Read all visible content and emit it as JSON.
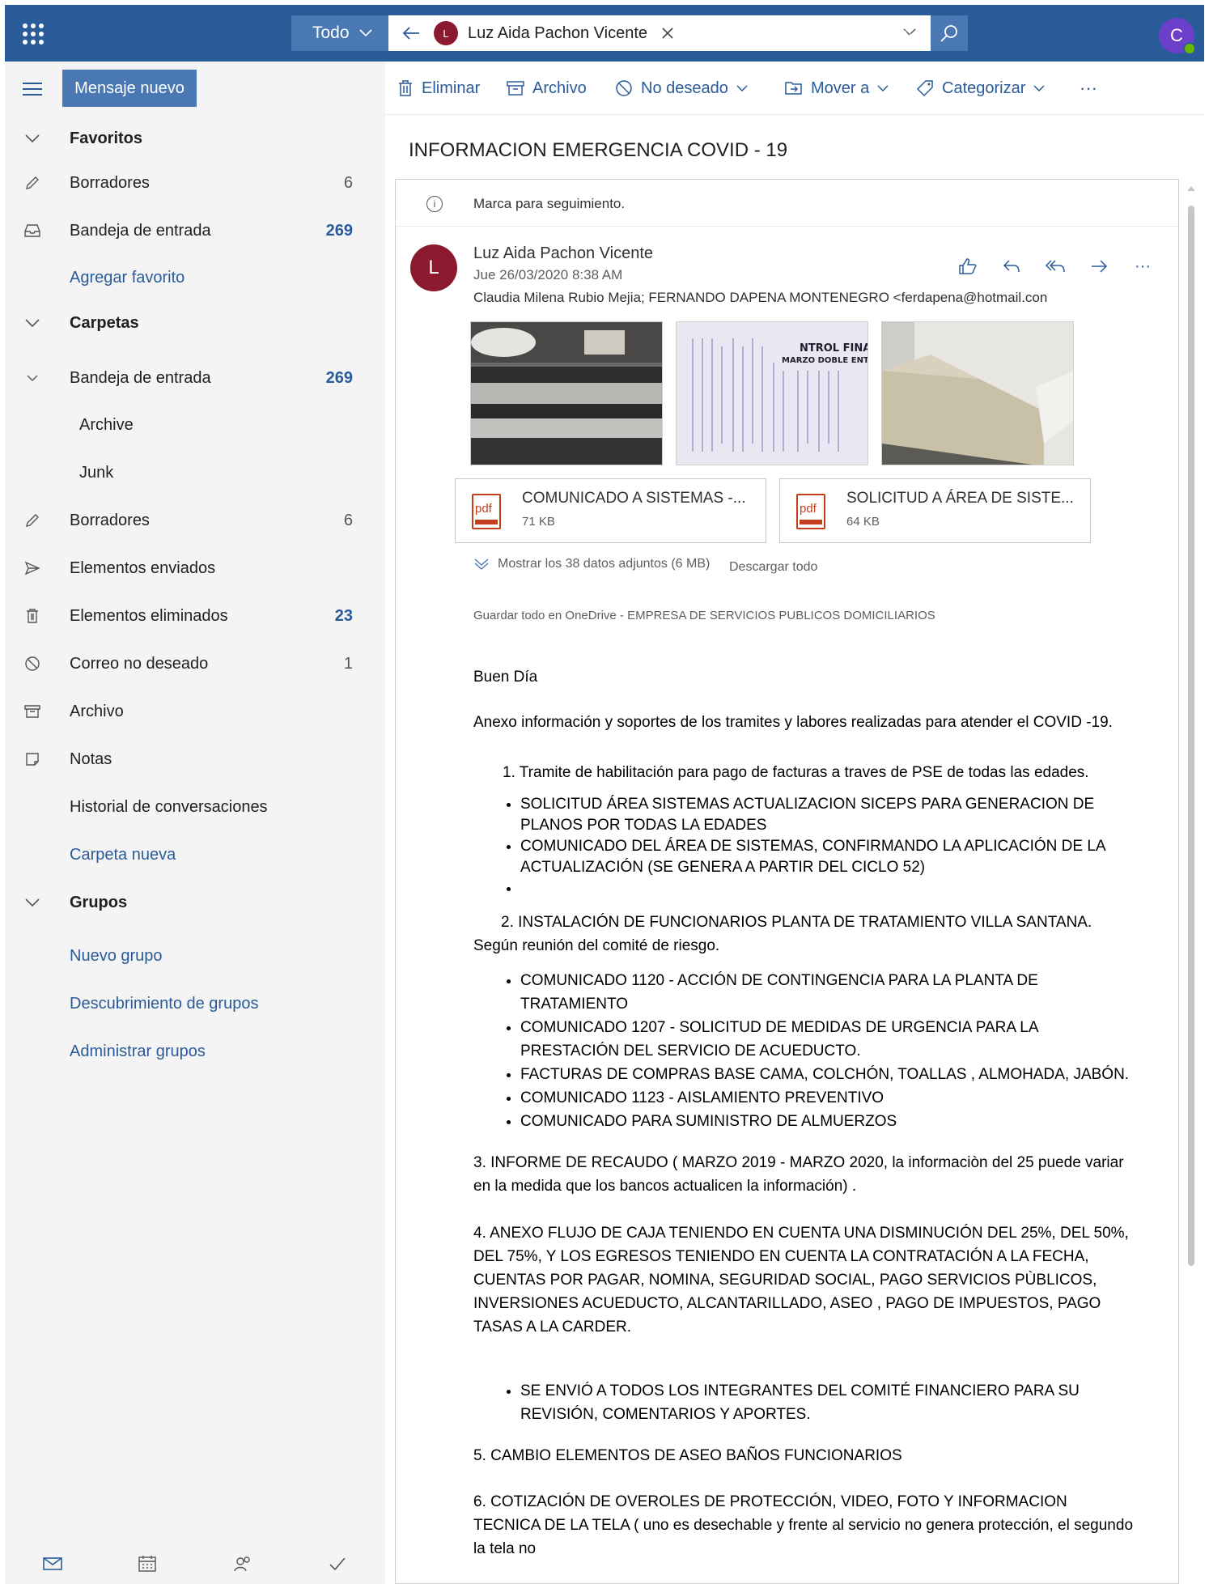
{
  "header": {
    "scope_label": "Todo",
    "search_pill_initial": "L",
    "search_pill_name": "Luz Aida Pachon Vicente",
    "user_initial": "C"
  },
  "toolbar": {
    "new_message": "Mensaje nuevo",
    "delete": "Eliminar",
    "archive": "Archivo",
    "junk": "No deseado",
    "move": "Mover a",
    "categorize": "Categorizar",
    "more": "···"
  },
  "sidebar": {
    "favorites_header": "Favoritos",
    "favorites": [
      {
        "label": "Borradores",
        "count": "6"
      },
      {
        "label": "Bandeja de entrada",
        "count": "269"
      }
    ],
    "add_favorite": "Agregar favorito",
    "folders_header": "Carpetas",
    "inbox": {
      "label": "Bandeja de entrada",
      "count": "269"
    },
    "inbox_children": [
      "Archive",
      "Junk"
    ],
    "folders": [
      {
        "label": "Borradores",
        "count": "6"
      },
      {
        "label": "Elementos enviados",
        "count": ""
      },
      {
        "label": "Elementos eliminados",
        "count": "23"
      },
      {
        "label": "Correo no deseado",
        "count": "1"
      },
      {
        "label": "Archivo",
        "count": ""
      },
      {
        "label": "Notas",
        "count": ""
      },
      {
        "label": "Historial de conversaciones",
        "count": ""
      }
    ],
    "new_folder": "Carpeta nueva",
    "groups_header": "Grupos",
    "group_links": [
      "Nuevo grupo",
      "Descubrimiento de grupos",
      "Administrar grupos"
    ]
  },
  "message": {
    "subject": "INFORMACION EMERGENCIA COVID - 19",
    "flag_notice": "Marca para seguimiento.",
    "sender_initial": "L",
    "sender": "Luz Aida Pachon Vicente",
    "date": "Jue 26/03/2020 8:38 AM",
    "recipients": "Claudia Milena Rubio Mejia; FERNANDO DAPENA MONTENEGRO <ferdapena@hotmail.con",
    "image_thumb_text": [
      "NTROL FINAL",
      "MARZO DOBLE ENTRADAS"
    ],
    "attachments": [
      {
        "icon": "pdf",
        "name": "COMUNICADO A SISTEMAS -...",
        "size": "71 KB"
      },
      {
        "icon": "pdf",
        "name": "SOLICITUD A ÁREA DE SISTE...",
        "size": "64 KB"
      }
    ],
    "show_all_attachments": "Mostrar los 38 datos adjuntos (6 MB)",
    "download_all": "Descargar todo",
    "save_onedrive": "Guardar todo en OneDrive - EMPRESA DE SERVICIOS PUBLICOS DOMICILIARIOS",
    "body": {
      "greeting": "Buen Día",
      "intro": "Anexo información y soportes de los tramites y labores realizadas para atender el COVID -19.",
      "item1": "1. Tramite de habilitación para pago de facturas a traves de PSE de todas las edades.",
      "item1_bullets": [
        "SOLICITUD ÁREA SISTEMAS ACTUALIZACION SICEPS PARA GENERACION DE PLANOS POR TODAS LA EDADES",
        "COMUNICADO DEL ÁREA DE SISTEMAS, CONFIRMANDO LA APLICACIÓN DE LA ACTUALIZACIÓN (SE GENERA A PARTIR DEL CICLO 52)",
        ""
      ],
      "item2": "2.  INSTALACIÓN DE FUNCIONARIOS PLANTA DE TRATAMIENTO VILLA SANTANA. Según reunión del comité de riesgo.",
      "item2_bullets": [
        "COMUNICADO 1120 - ACCIÓN DE CONTINGENCIA PARA LA PLANTA DE TRATAMIENTO",
        "COMUNICADO 1207 - SOLICITUD DE MEDIDAS DE URGENCIA PARA LA PRESTACIÓN DEL SERVICIO DE ACUEDUCTO.",
        "FACTURAS DE COMPRAS BASE CAMA, COLCHÓN, TOALLAS , ALMOHADA, JABÓN.",
        "COMUNICADO 1123 - AISLAMIENTO PREVENTIVO",
        "COMUNICADO PARA SUMINISTRO DE ALMUERZOS"
      ],
      "item3": "3. INFORME DE RECAUDO ( MARZO 2019 - MARZO 2020, la informaciòn del 25 puede variar en la medida que los bancos actualicen la información) .",
      "item4": "4. ANEXO FLUJO DE CAJA TENIENDO EN CUENTA UNA DISMINUCIÓN DEL 25%, DEL 50%, DEL 75%, Y LOS EGRESOS TENIENDO EN CUENTA LA CONTRATACIÓN A LA FECHA, CUENTAS POR PAGAR, NOMINA, SEGURIDAD SOCIAL, PAGO SERVICIOS PÙBLICOS, INVERSIONES ACUEDUCTO, ALCANTARILLADO, ASEO , PAGO DE IMPUESTOS, PAGO TASAS A LA CARDER.",
      "item4_bullets": [
        "SE ENVIÓ A TODOS LOS INTEGRANTES DEL COMITÉ FINANCIERO PARA SU REVISIÓN, COMENTARIOS Y APORTES."
      ],
      "item5": "5. CAMBIO ELEMENTOS DE ASEO BAÑOS FUNCIONARIOS",
      "item6": "6. COTIZACIÓN DE OVEROLES DE PROTECCIÓN, VIDEO, FOTO Y INFORMACION TECNICA DE LA TELA ( uno es desechable y frente al servicio no genera protección, el segundo la tela no"
    }
  },
  "colors": {
    "brand": "#2a5b99",
    "brand_light": "#4a78b3",
    "sender_avatar": "#8b1a2e",
    "user_avatar": "#6b3fc9",
    "presence": "#6bb700",
    "pdf": "#c43e1c"
  }
}
